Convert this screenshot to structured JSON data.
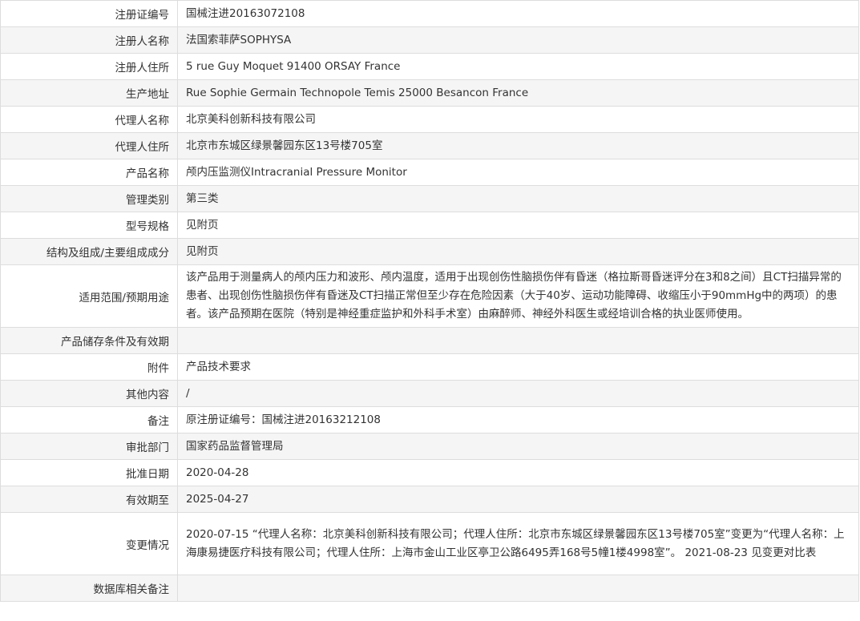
{
  "rows": [
    {
      "label": "注册证编号",
      "value": "国械注进20163072108"
    },
    {
      "label": "注册人名称",
      "value": "法国索菲萨SOPHYSA"
    },
    {
      "label": "注册人住所",
      "value": "5 rue Guy Moquet 91400 ORSAY France"
    },
    {
      "label": "生产地址",
      "value": "Rue Sophie Germain Technopole Temis 25000 Besancon France"
    },
    {
      "label": "代理人名称",
      "value": "北京美科创新科技有限公司"
    },
    {
      "label": "代理人住所",
      "value": "北京市东城区绿景馨园东区13号楼705室"
    },
    {
      "label": "产品名称",
      "value": "颅内压监测仪Intracranial Pressure Monitor"
    },
    {
      "label": "管理类别",
      "value": "第三类"
    },
    {
      "label": "型号规格",
      "value": "见附页"
    },
    {
      "label": "结构及组成/主要组成成分",
      "value": "见附页"
    },
    {
      "label": "适用范围/预期用途",
      "value": "该产品用于测量病人的颅内压力和波形、颅内温度，适用于出现创伤性脑损伤伴有昏迷（格拉斯哥昏迷评分在3和8之间）且CT扫描异常的患者、出现创伤性脑损伤伴有昏迷及CT扫描正常但至少存在危险因素（大于40岁、运动功能障碍、收缩压小于90mmHg中的两项）的患者。该产品预期在医院（特别是神经重症监护和外科手术室）由麻醉师、神经外科医生或经培训合格的执业医师使用。"
    },
    {
      "label": "产品储存条件及有效期",
      "value": ""
    },
    {
      "label": "附件",
      "value": "产品技术要求"
    },
    {
      "label": "其他内容",
      "value": "/"
    },
    {
      "label": "备注",
      "value": "原注册证编号：国械注进20163212108"
    },
    {
      "label": "审批部门",
      "value": "国家药品监督管理局"
    },
    {
      "label": "批准日期",
      "value": "2020-04-28"
    },
    {
      "label": "有效期至",
      "value": "2025-04-27"
    },
    {
      "label": "变更情况",
      "value": "2020-07-15 “代理人名称：北京美科创新科技有限公司；代理人住所：北京市东城区绿景馨园东区13号楼705室”变更为“代理人名称：上海康易捷医疗科技有限公司；代理人住所：上海市金山工业区亭卫公路6495弄168号5幢1楼4998室”。 2021-08-23 见变更对比表"
    },
    {
      "label": "数据库相关备注",
      "value": ""
    }
  ]
}
